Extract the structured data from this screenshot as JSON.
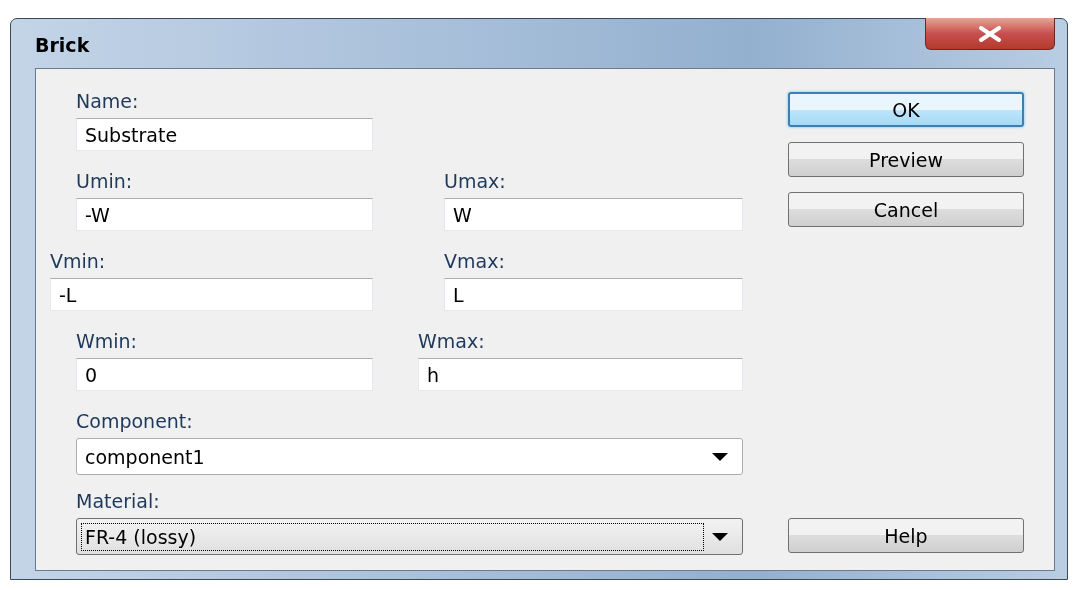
{
  "window": {
    "title": "Brick"
  },
  "name": {
    "label": "Name:",
    "value": "Substrate"
  },
  "ranges": [
    {
      "label": "Umin:",
      "value": "-W"
    },
    {
      "label": "Umax:",
      "value": "W"
    },
    {
      "label": "Vmin:",
      "value": "-L"
    },
    {
      "label": "Vmax:",
      "value": "L"
    },
    {
      "label": "Wmin:",
      "value": "0"
    },
    {
      "label": "Wmax:",
      "value": "h"
    }
  ],
  "component": {
    "label": "Component:",
    "value": "component1",
    "focused": false
  },
  "material": {
    "label": "Material:",
    "value": "FR-4 (lossy)",
    "focused": true
  },
  "buttons": [
    {
      "label": "OK",
      "default": true
    },
    {
      "label": "Preview",
      "default": false
    },
    {
      "label": "Cancel",
      "default": false
    }
  ],
  "help_button": {
    "label": "Help",
    "default": false
  }
}
